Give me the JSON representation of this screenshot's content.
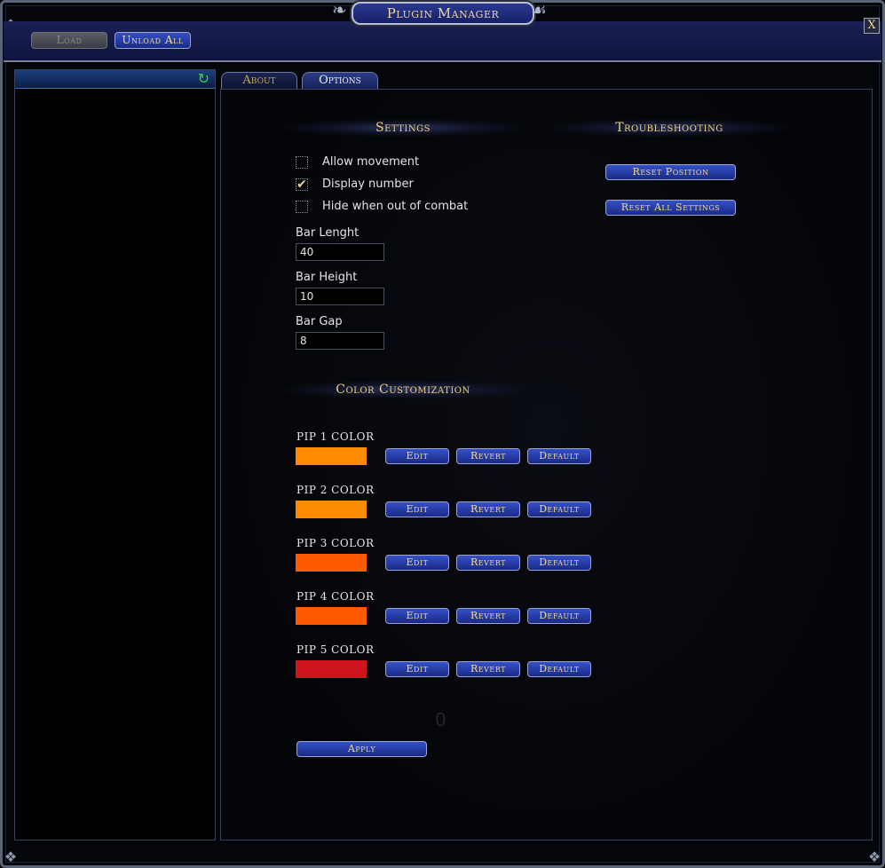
{
  "window": {
    "title": "Plugin Manager",
    "close_label": "X"
  },
  "toolbar": {
    "load_label": "Load",
    "unload_all_label": "Unload All"
  },
  "tabs": [
    {
      "label": "About",
      "active": false
    },
    {
      "label": "Options",
      "active": true
    }
  ],
  "settings": {
    "title": "Settings",
    "checkboxes": [
      {
        "label": "Allow movement",
        "checked": false
      },
      {
        "label": "Display number",
        "checked": true
      },
      {
        "label": "Hide when out of combat",
        "checked": false
      }
    ],
    "fields": [
      {
        "label": "Bar Lenght",
        "value": "40"
      },
      {
        "label": "Bar Height",
        "value": "10"
      },
      {
        "label": "Bar Gap",
        "value": "8"
      }
    ]
  },
  "troubleshooting": {
    "title": "Troubleshooting",
    "reset_position_label": "Reset Position",
    "reset_all_label": "Reset All Settings"
  },
  "colors": {
    "title": "Color Customization",
    "edit_label": "Edit",
    "revert_label": "Revert",
    "default_label": "Default",
    "pips": [
      {
        "label": "PIP 1 COLOR",
        "color": "#ff8c00"
      },
      {
        "label": "PIP 2 COLOR",
        "color": "#ff8c00"
      },
      {
        "label": "PIP 3 COLOR",
        "color": "#ff5a00"
      },
      {
        "label": "PIP 4 COLOR",
        "color": "#ff5a00"
      },
      {
        "label": "PIP 5 COLOR",
        "color": "#d0141e"
      }
    ]
  },
  "faint_number": "0",
  "apply_label": "Apply"
}
